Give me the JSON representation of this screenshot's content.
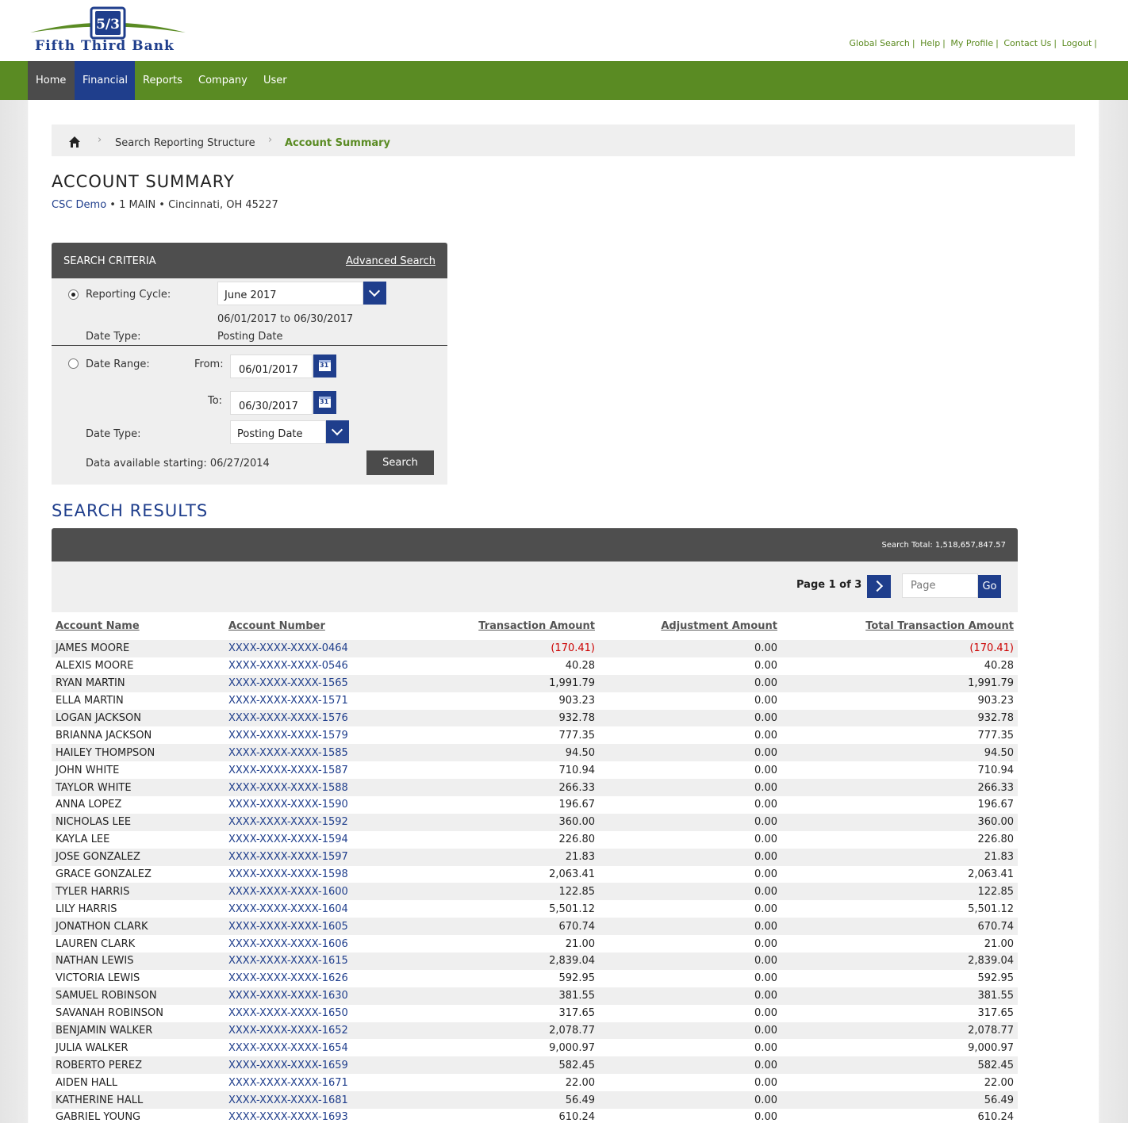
{
  "brand": {
    "name": "Fifth Third Bank",
    "logo_mark": "5/3"
  },
  "utility_links": [
    "Global Search",
    "Help",
    "My Profile",
    "Contact Us",
    "Logout"
  ],
  "nav": {
    "home": "Home",
    "financial": "Financial",
    "reports": "Reports",
    "company": "Company",
    "user": "User"
  },
  "breadcrumb": {
    "item1": "Search Reporting Structure",
    "current": "Account Summary"
  },
  "page": {
    "title": "ACCOUNT SUMMARY",
    "company_link": "CSC Demo",
    "company_rest": " • 1 MAIN • Cincinnati, OH 45227"
  },
  "search": {
    "title": "SEARCH CRITERIA",
    "advanced_link": "Advanced Search",
    "reporting_cycle_label": "Reporting Cycle:",
    "reporting_cycle_value": "June 2017",
    "cycle_dates": "06/01/2017 to 06/30/2017",
    "date_type_label": "Date Type:",
    "cycle_date_type": "Posting Date",
    "date_range_label": "Date Range:",
    "from_label": "From:",
    "from_value": "06/01/2017",
    "to_label": "To:",
    "to_value": "06/30/2017",
    "range_date_type_label": "Date Type:",
    "range_date_type_value": "Posting Date",
    "data_available": "Data available starting: 06/27/2014",
    "search_button": "Search"
  },
  "results": {
    "title": "SEARCH RESULTS",
    "total": "Search Total: 1,518,657,847.57",
    "pager_text": "Page 1 of 3",
    "page_placeholder": "Page",
    "go_label": "Go",
    "columns": [
      "Account Name",
      "Account Number",
      "Transaction Amount",
      "Adjustment Amount",
      "Total Transaction Amount"
    ],
    "rows": [
      [
        "JAMES MOORE",
        "XXXX-XXXX-XXXX-0464",
        "(170.41)",
        "0.00",
        "(170.41)"
      ],
      [
        "ALEXIS MOORE",
        "XXXX-XXXX-XXXX-0546",
        "40.28",
        "0.00",
        "40.28"
      ],
      [
        "RYAN MARTIN",
        "XXXX-XXXX-XXXX-1565",
        "1,991.79",
        "0.00",
        "1,991.79"
      ],
      [
        "ELLA MARTIN",
        "XXXX-XXXX-XXXX-1571",
        "903.23",
        "0.00",
        "903.23"
      ],
      [
        "LOGAN JACKSON",
        "XXXX-XXXX-XXXX-1576",
        "932.78",
        "0.00",
        "932.78"
      ],
      [
        "BRIANNA JACKSON",
        "XXXX-XXXX-XXXX-1579",
        "777.35",
        "0.00",
        "777.35"
      ],
      [
        "HAILEY THOMPSON",
        "XXXX-XXXX-XXXX-1585",
        "94.50",
        "0.00",
        "94.50"
      ],
      [
        "JOHN WHITE",
        "XXXX-XXXX-XXXX-1587",
        "710.94",
        "0.00",
        "710.94"
      ],
      [
        "TAYLOR WHITE",
        "XXXX-XXXX-XXXX-1588",
        "266.33",
        "0.00",
        "266.33"
      ],
      [
        "ANNA LOPEZ",
        "XXXX-XXXX-XXXX-1590",
        "196.67",
        "0.00",
        "196.67"
      ],
      [
        "NICHOLAS LEE",
        "XXXX-XXXX-XXXX-1592",
        "360.00",
        "0.00",
        "360.00"
      ],
      [
        "KAYLA LEE",
        "XXXX-XXXX-XXXX-1594",
        "226.80",
        "0.00",
        "226.80"
      ],
      [
        "JOSE GONZALEZ",
        "XXXX-XXXX-XXXX-1597",
        "21.83",
        "0.00",
        "21.83"
      ],
      [
        "GRACE GONZALEZ",
        "XXXX-XXXX-XXXX-1598",
        "2,063.41",
        "0.00",
        "2,063.41"
      ],
      [
        "TYLER HARRIS",
        "XXXX-XXXX-XXXX-1600",
        "122.85",
        "0.00",
        "122.85"
      ],
      [
        "LILY HARRIS",
        "XXXX-XXXX-XXXX-1604",
        "5,501.12",
        "0.00",
        "5,501.12"
      ],
      [
        "JONATHON CLARK",
        "XXXX-XXXX-XXXX-1605",
        "670.74",
        "0.00",
        "670.74"
      ],
      [
        "LAUREN CLARK",
        "XXXX-XXXX-XXXX-1606",
        "21.00",
        "0.00",
        "21.00"
      ],
      [
        "NATHAN LEWIS",
        "XXXX-XXXX-XXXX-1615",
        "2,839.04",
        "0.00",
        "2,839.04"
      ],
      [
        "VICTORIA LEWIS",
        "XXXX-XXXX-XXXX-1626",
        "592.95",
        "0.00",
        "592.95"
      ],
      [
        "SAMUEL ROBINSON",
        "XXXX-XXXX-XXXX-1630",
        "381.55",
        "0.00",
        "381.55"
      ],
      [
        "SAVANAH ROBINSON",
        "XXXX-XXXX-XXXX-1650",
        "317.65",
        "0.00",
        "317.65"
      ],
      [
        "BENJAMIN WALKER",
        "XXXX-XXXX-XXXX-1652",
        "2,078.77",
        "0.00",
        "2,078.77"
      ],
      [
        "JULIA WALKER",
        "XXXX-XXXX-XXXX-1654",
        "9,000.97",
        "0.00",
        "9,000.97"
      ],
      [
        "ROBERTO PEREZ",
        "XXXX-XXXX-XXXX-1659",
        "582.45",
        "0.00",
        "582.45"
      ],
      [
        "AIDEN HALL",
        "XXXX-XXXX-XXXX-1671",
        "22.00",
        "0.00",
        "22.00"
      ],
      [
        "KATHERINE HALL",
        "XXXX-XXXX-XXXX-1681",
        "56.49",
        "0.00",
        "56.49"
      ],
      [
        "GABRIEL YOUNG",
        "XXXX-XXXX-XXXX-1693",
        "610.24",
        "0.00",
        "610.24"
      ]
    ]
  },
  "colors": {
    "nav_green": "#5a8b23",
    "brand_blue": "#1f3e8c",
    "dark_gray": "#4e4e4e",
    "negative_red": "#cc0000"
  }
}
